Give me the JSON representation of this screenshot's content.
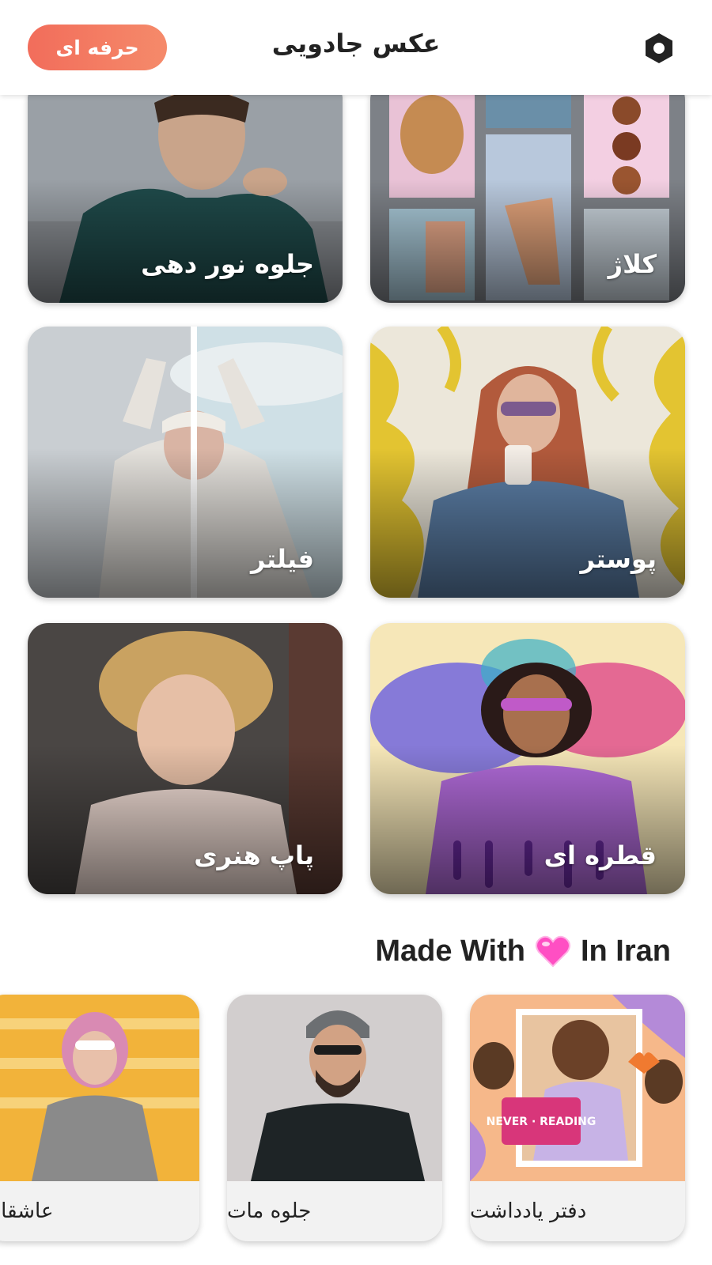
{
  "header": {
    "title": "عکس جادویی",
    "pro_label": "حرفه ای",
    "settings_icon": "settings-hexagon-icon"
  },
  "features": [
    {
      "label": "جلوه نور دهی"
    },
    {
      "label": "کلاژ"
    },
    {
      "label": "فیلتر"
    },
    {
      "label": "پوستر"
    },
    {
      "label": "پاپ هنری"
    },
    {
      "label": "قطره ای"
    }
  ],
  "section": {
    "made_with": "Made With",
    "in_iran": "In Iran",
    "heart_icon": "pink-heart-icon"
  },
  "carousel": [
    {
      "label": "عاشقانه"
    },
    {
      "label": "جلوه مات"
    },
    {
      "label": "دفتر یادداشت"
    }
  ],
  "colors": {
    "pro_gradient_start": "#f26d5b",
    "pro_gradient_end": "#f58a6a",
    "heart": "#ff4fc3"
  }
}
